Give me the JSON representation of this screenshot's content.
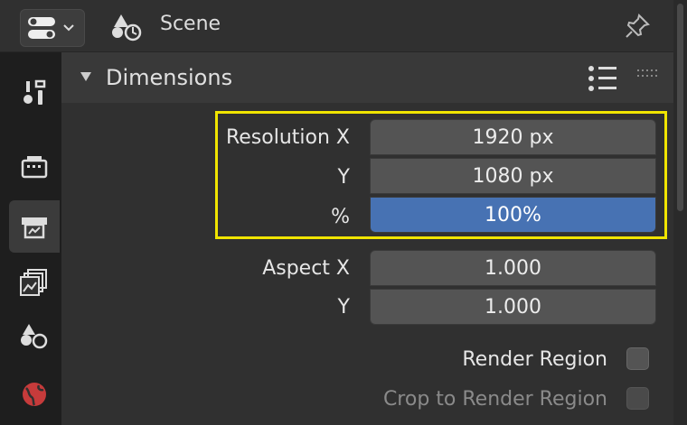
{
  "header": {
    "title": "Scene",
    "editor_icon": "properties-editor-icon",
    "context_icon": "scene-icon",
    "pin_icon": "pin-icon"
  },
  "tabs": [
    {
      "name": "tool",
      "icon": "wrench-screwdriver-icon",
      "active": false
    },
    {
      "name": "render",
      "icon": "camera-back-icon",
      "active": false
    },
    {
      "name": "output",
      "icon": "printer-icon",
      "active": true
    },
    {
      "name": "view-layer",
      "icon": "image-stack-icon",
      "active": false
    },
    {
      "name": "scene",
      "icon": "scene-icon",
      "active": false
    },
    {
      "name": "world",
      "icon": "world-icon",
      "active": false
    }
  ],
  "panel": {
    "title": "Dimensions",
    "list_icon": "list-icon",
    "drag_icon": "drag-handle-icon"
  },
  "fields": {
    "resolution_x_label": "Resolution X",
    "resolution_x": "1920 px",
    "resolution_y_label": "Y",
    "resolution_y": "1080 px",
    "percent_label": "%",
    "percent": "100%",
    "aspect_x_label": "Aspect X",
    "aspect_x": "1.000",
    "aspect_y_label": "Y",
    "aspect_y": "1.000"
  },
  "checkboxes": {
    "render_region": "Render Region",
    "crop_to_render_region": "Crop to Render Region"
  },
  "colors": {
    "selected_field": "#4772b3",
    "highlight_box": "#f0e400"
  }
}
